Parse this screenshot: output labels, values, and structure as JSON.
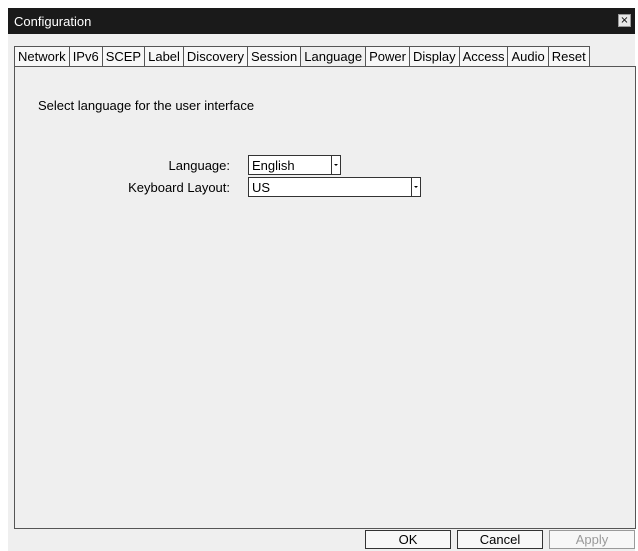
{
  "window": {
    "title": "Configuration",
    "close_label": "×"
  },
  "tabs": [
    {
      "label": "Network"
    },
    {
      "label": "IPv6"
    },
    {
      "label": "SCEP"
    },
    {
      "label": "Label"
    },
    {
      "label": "Discovery"
    },
    {
      "label": "Session"
    },
    {
      "label": "Language",
      "active": true
    },
    {
      "label": "Power"
    },
    {
      "label": "Display"
    },
    {
      "label": "Access"
    },
    {
      "label": "Audio"
    },
    {
      "label": "Reset"
    }
  ],
  "language_panel": {
    "instruction": "Select language for the user interface",
    "language_label": "Language:",
    "language_value": "English",
    "keyboard_label": "Keyboard Layout:",
    "keyboard_value": "US"
  },
  "footer": {
    "ok_label": "OK",
    "cancel_label": "Cancel",
    "apply_label": "Apply"
  }
}
